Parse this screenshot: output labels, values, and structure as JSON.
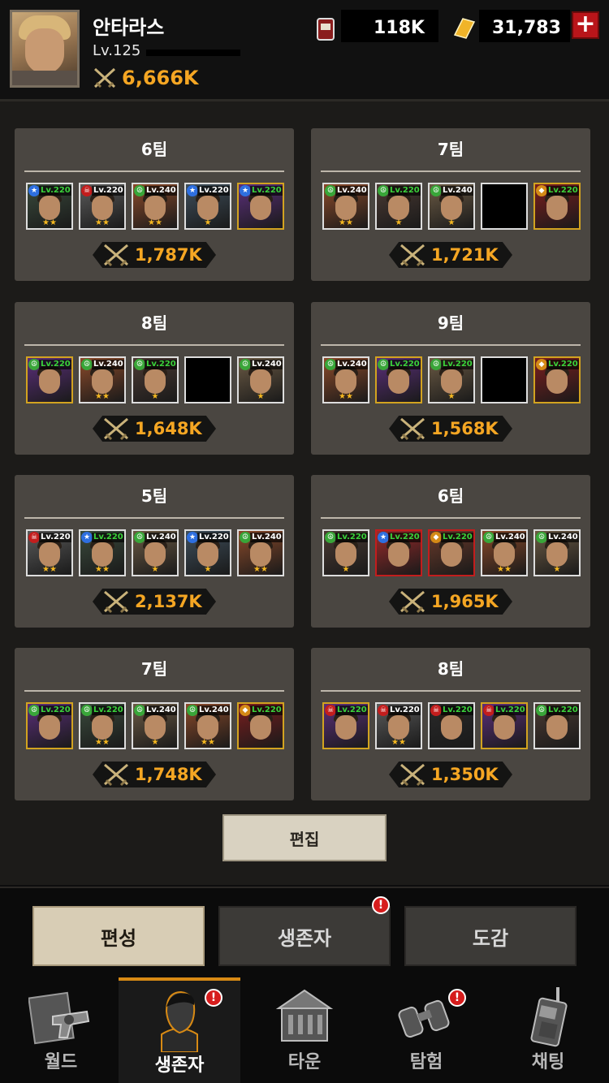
{
  "header": {
    "player_name": "안타라스",
    "player_level": "Lv.125",
    "power": "6,666K",
    "currency_1": "118K",
    "currency_2": "31,783",
    "currency_1_icon": "ration-can-icon",
    "currency_2_icon": "gold-bar-icon",
    "plus_label": "+"
  },
  "teams": [
    {
      "name": "6팀",
      "power": "1,787K",
      "heroes": [
        {
          "lv": "Lv.220",
          "lv_color": "#3ad13a",
          "frame": "#ddd",
          "bg": "#3a4a3c",
          "badge": "★",
          "badge_color": "#2e6fe0",
          "stars": "★★"
        },
        {
          "lv": "Lv.220",
          "lv_color": "#ffffff",
          "frame": "#ddd",
          "bg": "#5b5b5b",
          "badge": "☠",
          "badge_color": "#c31d1d",
          "stars": "★★"
        },
        {
          "lv": "Lv.240",
          "lv_color": "#ffffff",
          "frame": "#ddd",
          "bg": "#8b4a2a",
          "badge": "☮",
          "badge_color": "#39a639",
          "stars": "★★"
        },
        {
          "lv": "Lv.220",
          "lv_color": "#ffffff",
          "frame": "#ddd",
          "bg": "#3f4f5c",
          "badge": "★",
          "badge_color": "#2e6fe0",
          "stars": "★"
        },
        {
          "lv": "Lv.220",
          "lv_color": "#3ad13a",
          "frame": "#d2a320",
          "bg": "#5b2f7a",
          "badge": "★",
          "badge_color": "#2e6fe0",
          "stars": ""
        }
      ]
    },
    {
      "name": "7팀",
      "power": "1,721K",
      "heroes": [
        {
          "lv": "Lv.240",
          "lv_color": "#ffffff",
          "frame": "#ddd",
          "bg": "#8b4a2a",
          "badge": "☮",
          "badge_color": "#39a639",
          "stars": "★★"
        },
        {
          "lv": "Lv.220",
          "lv_color": "#3ad13a",
          "frame": "#ddd",
          "bg": "#4b3a33",
          "badge": "☮",
          "badge_color": "#39a639",
          "stars": "★"
        },
        {
          "lv": "Lv.240",
          "lv_color": "#ffffff",
          "frame": "#ddd",
          "bg": "#6b5a44",
          "badge": "☮",
          "badge_color": "#39a639",
          "stars": "★"
        },
        {
          "empty": true
        },
        {
          "lv": "Lv.220",
          "lv_color": "#3ad13a",
          "frame": "#d2a320",
          "bg": "#7a1e1e",
          "badge": "◆",
          "badge_color": "#d48a16",
          "stars": ""
        }
      ]
    },
    {
      "name": "8팀",
      "power": "1,648K",
      "heroes": [
        {
          "lv": "Lv.220",
          "lv_color": "#3ad13a",
          "frame": "#d2a320",
          "bg": "#5b2f7a",
          "badge": "☮",
          "badge_color": "#39a639",
          "stars": ""
        },
        {
          "lv": "Lv.240",
          "lv_color": "#ffffff",
          "frame": "#ddd",
          "bg": "#8b4a2a",
          "badge": "☮",
          "badge_color": "#39a639",
          "stars": "★★"
        },
        {
          "lv": "Lv.220",
          "lv_color": "#3ad13a",
          "frame": "#ddd",
          "bg": "#4b3a33",
          "badge": "☮",
          "badge_color": "#39a639",
          "stars": "★"
        },
        {
          "empty": true
        },
        {
          "lv": "Lv.240",
          "lv_color": "#ffffff",
          "frame": "#ddd",
          "bg": "#6b5a44",
          "badge": "☮",
          "badge_color": "#39a639",
          "stars": "★"
        }
      ]
    },
    {
      "name": "9팀",
      "power": "1,568K",
      "heroes": [
        {
          "lv": "Lv.240",
          "lv_color": "#ffffff",
          "frame": "#ddd",
          "bg": "#8b4a2a",
          "badge": "☮",
          "badge_color": "#39a639",
          "stars": "★★"
        },
        {
          "lv": "Lv.220",
          "lv_color": "#3ad13a",
          "frame": "#d2a320",
          "bg": "#5b2f7a",
          "badge": "☮",
          "badge_color": "#39a639",
          "stars": ""
        },
        {
          "lv": "Lv.220",
          "lv_color": "#3ad13a",
          "frame": "#ddd",
          "bg": "#6b5a44",
          "badge": "☮",
          "badge_color": "#39a639",
          "stars": "★"
        },
        {
          "empty": true
        },
        {
          "lv": "Lv.220",
          "lv_color": "#3ad13a",
          "frame": "#d2a320",
          "bg": "#7a1e1e",
          "badge": "◆",
          "badge_color": "#d48a16",
          "stars": ""
        }
      ]
    },
    {
      "name": "5팀",
      "power": "2,137K",
      "heroes": [
        {
          "lv": "Lv.220",
          "lv_color": "#ffffff",
          "frame": "#ddd",
          "bg": "#5b5b5b",
          "badge": "☠",
          "badge_color": "#c31d1d",
          "stars": "★★"
        },
        {
          "lv": "Lv.220",
          "lv_color": "#3ad13a",
          "frame": "#ddd",
          "bg": "#3a4a3c",
          "badge": "★",
          "badge_color": "#2e6fe0",
          "stars": "★★"
        },
        {
          "lv": "Lv.240",
          "lv_color": "#ffffff",
          "frame": "#ddd",
          "bg": "#6b5a44",
          "badge": "☮",
          "badge_color": "#39a639",
          "stars": "★"
        },
        {
          "lv": "Lv.220",
          "lv_color": "#ffffff",
          "frame": "#ddd",
          "bg": "#3f4f5c",
          "badge": "★",
          "badge_color": "#2e6fe0",
          "stars": "★"
        },
        {
          "lv": "Lv.240",
          "lv_color": "#ffffff",
          "frame": "#ddd",
          "bg": "#8b4a2a",
          "badge": "☮",
          "badge_color": "#39a639",
          "stars": "★★"
        }
      ]
    },
    {
      "name": "6팀",
      "power": "1,965K",
      "heroes": [
        {
          "lv": "Lv.220",
          "lv_color": "#3ad13a",
          "frame": "#ddd",
          "bg": "#4b3a33",
          "badge": "☮",
          "badge_color": "#39a639",
          "stars": "★"
        },
        {
          "lv": "Lv.220",
          "lv_color": "#3ad13a",
          "frame": "#c31d1d",
          "bg": "#9a2a2a",
          "badge": "★",
          "badge_color": "#2e6fe0",
          "stars": ""
        },
        {
          "lv": "Lv.220",
          "lv_color": "#3ad13a",
          "frame": "#c31d1d",
          "bg": "#6b3a2a",
          "badge": "◆",
          "badge_color": "#d48a16",
          "stars": ""
        },
        {
          "lv": "Lv.240",
          "lv_color": "#ffffff",
          "frame": "#ddd",
          "bg": "#8b4a2a",
          "badge": "☮",
          "badge_color": "#39a639",
          "stars": "★★"
        },
        {
          "lv": "Lv.240",
          "lv_color": "#ffffff",
          "frame": "#ddd",
          "bg": "#6b5a44",
          "badge": "☮",
          "badge_color": "#39a639",
          "stars": "★"
        }
      ]
    },
    {
      "name": "7팀",
      "power": "1,748K",
      "heroes": [
        {
          "lv": "Lv.220",
          "lv_color": "#3ad13a",
          "frame": "#d2a320",
          "bg": "#5b2f7a",
          "badge": "☮",
          "badge_color": "#39a639",
          "stars": ""
        },
        {
          "lv": "Lv.220",
          "lv_color": "#3ad13a",
          "frame": "#ddd",
          "bg": "#3a4a3c",
          "badge": "☮",
          "badge_color": "#39a639",
          "stars": "★★"
        },
        {
          "lv": "Lv.240",
          "lv_color": "#ffffff",
          "frame": "#ddd",
          "bg": "#6b5a44",
          "badge": "☮",
          "badge_color": "#39a639",
          "stars": "★"
        },
        {
          "lv": "Lv.240",
          "lv_color": "#ffffff",
          "frame": "#ddd",
          "bg": "#8b4a2a",
          "badge": "☮",
          "badge_color": "#39a639",
          "stars": "★★"
        },
        {
          "lv": "Lv.220",
          "lv_color": "#3ad13a",
          "frame": "#d2a320",
          "bg": "#7a1e1e",
          "badge": "◆",
          "badge_color": "#d48a16",
          "stars": ""
        }
      ]
    },
    {
      "name": "8팀",
      "power": "1,350K",
      "heroes": [
        {
          "lv": "Lv.220",
          "lv_color": "#3ad13a",
          "frame": "#d2a320",
          "bg": "#5b2f7a",
          "badge": "☠",
          "badge_color": "#c31d1d",
          "stars": ""
        },
        {
          "lv": "Lv.220",
          "lv_color": "#ffffff",
          "frame": "#ddd",
          "bg": "#5b5b5b",
          "badge": "☠",
          "badge_color": "#c31d1d",
          "stars": "★★"
        },
        {
          "lv": "Lv.220",
          "lv_color": "#3ad13a",
          "frame": "#ddd",
          "bg": "#2a2a2a",
          "badge": "☠",
          "badge_color": "#c31d1d",
          "stars": ""
        },
        {
          "lv": "Lv.220",
          "lv_color": "#3ad13a",
          "frame": "#d2a320",
          "bg": "#5b2f7a",
          "badge": "☠",
          "badge_color": "#c31d1d",
          "stars": ""
        },
        {
          "lv": "Lv.220",
          "lv_color": "#3ad13a",
          "frame": "#ddd",
          "bg": "#4b3a33",
          "badge": "☮",
          "badge_color": "#39a639",
          "stars": ""
        }
      ]
    }
  ],
  "edit_button": "편집",
  "subtabs": [
    {
      "label": "편성",
      "active": true,
      "alert": false
    },
    {
      "label": "생존자",
      "active": false,
      "alert": true
    },
    {
      "label": "도감",
      "active": false,
      "alert": false
    }
  ],
  "nav": [
    {
      "label": "월드",
      "icon": "world-revolver-icon",
      "active": false,
      "alert": false
    },
    {
      "label": "생존자",
      "icon": "survivor-portrait-icon",
      "active": true,
      "alert": true
    },
    {
      "label": "타운",
      "icon": "town-building-icon",
      "active": false,
      "alert": false
    },
    {
      "label": "탐험",
      "icon": "binoculars-icon",
      "active": false,
      "alert": true
    },
    {
      "label": "채팅",
      "icon": "walkie-talkie-icon",
      "active": false,
      "alert": false
    }
  ],
  "alert_mark": "!",
  "colors": {
    "accent_gold": "#f5a623",
    "nav_active": "#d88a14",
    "alert_red": "#d61c1c"
  }
}
